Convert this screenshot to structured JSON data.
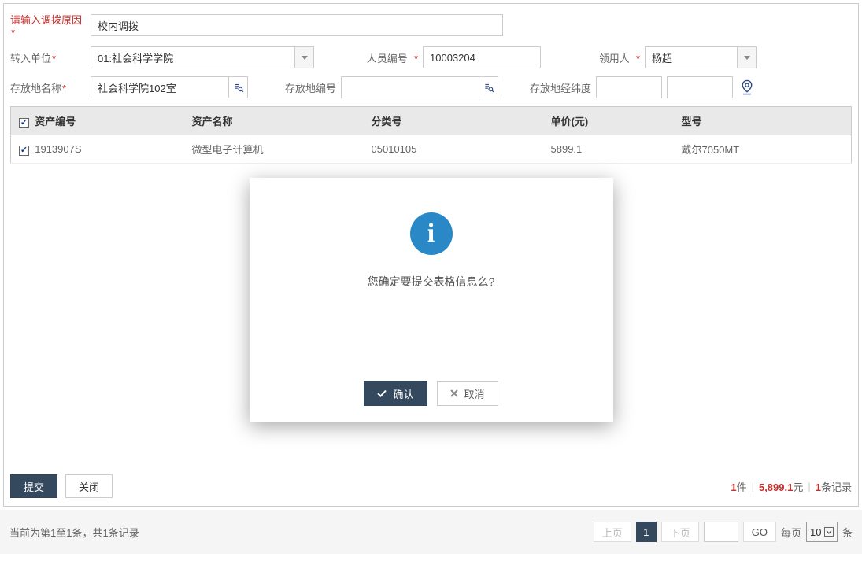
{
  "form": {
    "reason_label": "请输入调拨原因",
    "reason_value": "校内调拨",
    "dept_label": "转入单位",
    "dept_value": "01:社会科学学院",
    "emp_label": "人员编号",
    "emp_value": "10003204",
    "recipient_label": "领用人",
    "recipient_value": "杨超",
    "loc_name_label": "存放地名称",
    "loc_name_value": "社会科学院102室",
    "loc_code_label": "存放地编号",
    "loc_code_value": "",
    "loc_coord_label": "存放地经纬度",
    "loc_coord_value": ""
  },
  "table": {
    "headers": [
      "资产编号",
      "资产名称",
      "分类号",
      "单价(元)",
      "型号"
    ],
    "rows": [
      {
        "asset_no": "1913907S",
        "asset_name": "微型电子计算机",
        "class_no": "05010105",
        "price": "5899.1",
        "model": "戴尔7050MT"
      }
    ]
  },
  "actions": {
    "submit": "提交",
    "close": "关闭"
  },
  "summary": {
    "count": "1",
    "count_suffix": "件",
    "amount": "5,899.1",
    "amount_suffix": "元",
    "records": "1",
    "records_suffix": "条记录"
  },
  "pager": {
    "status": "当前为第1至1条，共1条记录",
    "prev": "上页",
    "current": "1",
    "next": "下页",
    "go": "GO",
    "per_page_label": "每页",
    "per_page_value": "10",
    "tail": "条"
  },
  "modal": {
    "message": "您确定要提交表格信息么?",
    "confirm": "确认",
    "cancel": "取消"
  }
}
